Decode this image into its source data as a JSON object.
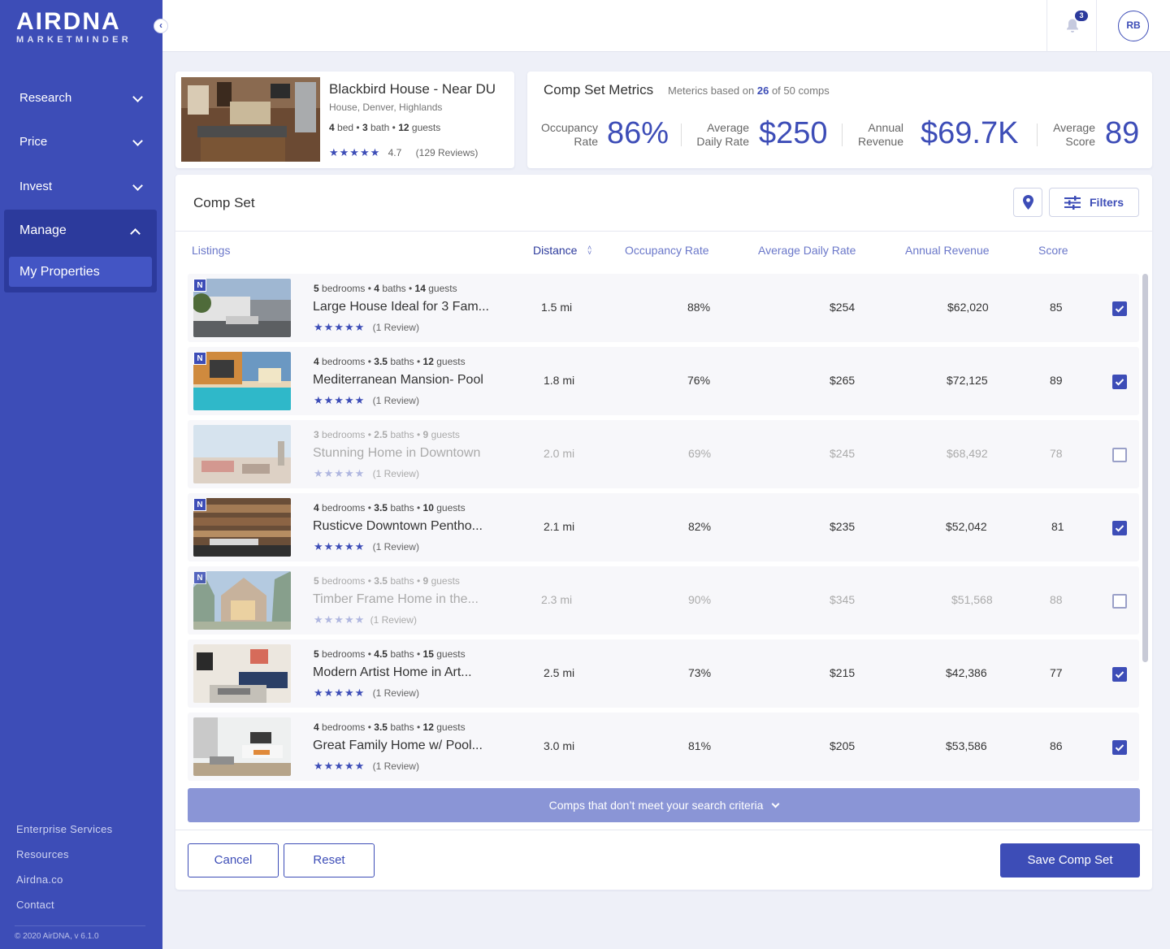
{
  "brand": {
    "name": "AIRDNA",
    "sub": "MARKETMINDER"
  },
  "sidebar": {
    "collapse_icon": "chevron-left-icon",
    "nav": [
      {
        "label": "Research"
      },
      {
        "label": "Price"
      },
      {
        "label": "Invest"
      },
      {
        "label": "Manage"
      }
    ],
    "active_sub": "My Properties",
    "footer_links": [
      "Enterprise Services",
      "Resources",
      "Airdna.co",
      "Contact"
    ],
    "copyright": "© 2020 AirDNA, v 6.1.0"
  },
  "topbar": {
    "notifications": "3",
    "avatar": "RB"
  },
  "property": {
    "title": "Blackbird House - Near DU",
    "subtitle": "House, Denver, Highlands",
    "beds": "4",
    "beds_label": "bed",
    "baths": "3",
    "baths_label": "bath",
    "guests": "12",
    "guests_label": "guests",
    "stars": "★★★★★",
    "rating": "4.7",
    "reviews": "(129 Reviews)"
  },
  "metrics": {
    "title": "Comp Set Metrics",
    "note_prefix": "Meterics based on",
    "note_count": "26",
    "note_suffix": "of 50 comps",
    "items": [
      {
        "label1": "Occupancy",
        "label2": "Rate",
        "value": "86%"
      },
      {
        "label1": "Average",
        "label2": "Daily Rate",
        "value": "$250"
      },
      {
        "label1": "Annual",
        "label2": "Revenue",
        "value": "$69.7K"
      },
      {
        "label1": "Average",
        "label2": "Score",
        "value": "89"
      }
    ]
  },
  "comp_set": {
    "title": "Comp Set",
    "filters_label": "Filters",
    "columns": [
      "Listings",
      "Distance",
      "Occupancy Rate",
      "Average Daily Rate",
      "Annual Revenue",
      "Score"
    ],
    "rows": [
      {
        "beds": "5",
        "baths": "4",
        "guests": "14",
        "name": "Large House Ideal for 3 Fam...",
        "stars": "★★★★★",
        "reviews": "(1 Review)",
        "distance": "1.5 mi",
        "occupancy": "88%",
        "adr": "$254",
        "revenue": "$62,020",
        "score": "85",
        "checked": true,
        "badge": true
      },
      {
        "beds": "4",
        "baths": "3.5",
        "guests": "12",
        "name": "Mediterranean Mansion- Pool",
        "stars": "★★★★★",
        "reviews": "(1 Review)",
        "distance": "1.8 mi",
        "occupancy": "76%",
        "adr": "$265",
        "revenue": "$72,125",
        "score": "89",
        "checked": true,
        "badge": true
      },
      {
        "beds": "3",
        "baths": "2.5",
        "guests": "9",
        "name": "Stunning Home in Downtown",
        "stars": "★★★★★",
        "reviews": "(1 Review)",
        "distance": "2.0 mi",
        "occupancy": "69%",
        "adr": "$245",
        "revenue": "$68,492",
        "score": "78",
        "checked": false,
        "badge": false
      },
      {
        "beds": "4",
        "baths": "3.5",
        "guests": "10",
        "name": "Rusticve Downtown Pentho...",
        "stars": "★★★★★",
        "reviews": "(1 Review)",
        "distance": "2.1 mi",
        "occupancy": "82%",
        "adr": "$235",
        "revenue": "$52,042",
        "score": "81",
        "checked": true,
        "badge": true
      },
      {
        "beds": "5",
        "baths": "3.5",
        "guests": "9",
        "name": "Timber Frame Home in the...",
        "stars": "★★★★★",
        "reviews": "(1 Review)",
        "distance": "2.3 mi",
        "occupancy": "90%",
        "adr": "$345",
        "revenue": "$51,568",
        "score": "88",
        "checked": false,
        "badge": true
      },
      {
        "beds": "5",
        "baths": "4.5",
        "guests": "15",
        "name": "Modern Artist Home in Art...",
        "stars": "★★★★★",
        "reviews": "(1 Review)",
        "distance": "2.5 mi",
        "occupancy": "73%",
        "adr": "$215",
        "revenue": "$42,386",
        "score": "77",
        "checked": true,
        "badge": false
      },
      {
        "beds": "4",
        "baths": "3.5",
        "guests": "12",
        "name": "Great Family Home w/ Pool...",
        "stars": "★★★★★",
        "reviews": "(1 Review)",
        "distance": "3.0 mi",
        "occupancy": "81%",
        "adr": "$205",
        "revenue": "$53,586",
        "score": "86",
        "checked": true,
        "badge": false
      }
    ],
    "labels": {
      "bedrooms": "bedrooms",
      "baths": "baths",
      "guests": "guests"
    },
    "more_label": "Comps that don’t meet your search criteria",
    "cancel_label": "Cancel",
    "reset_label": "Reset",
    "save_label": "Save Comp Set"
  },
  "colors": {
    "brand": "#3d4db7",
    "sidebar_dark": "#2c3a9c",
    "more_bar": "#8a95d6"
  }
}
